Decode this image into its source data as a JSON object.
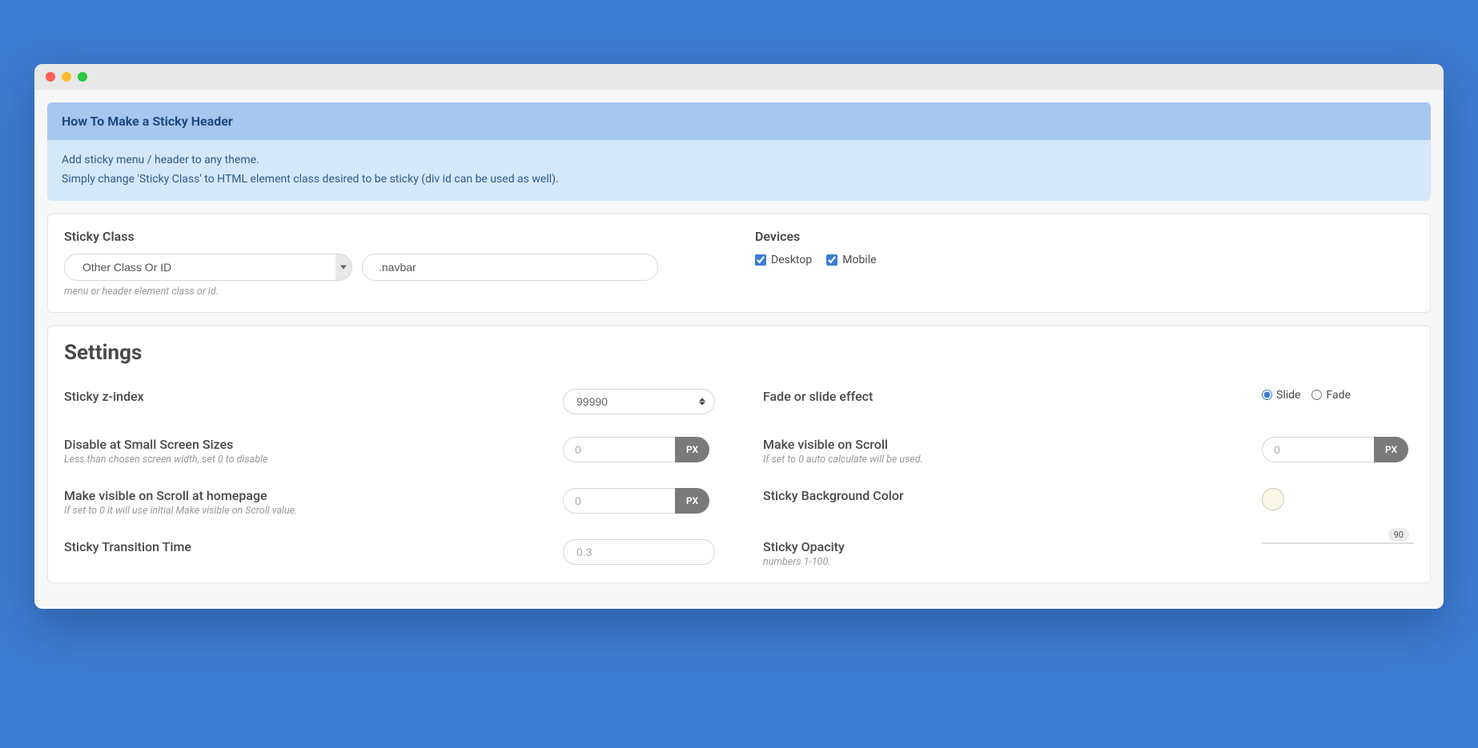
{
  "header": {
    "title": "How To Make a Sticky Header",
    "line1": "Add sticky menu / header to any theme.",
    "line2": "Simply change 'Sticky Class' to HTML element class desired to be sticky (div id can be used as well)."
  },
  "sticky_class": {
    "label": "Sticky Class",
    "select": "Other Class Or ID",
    "value": ".navbar",
    "hint": "menu or header element class or id."
  },
  "devices": {
    "label": "Devices",
    "desktop": "Desktop",
    "mobile": "Mobile"
  },
  "settings": {
    "title": "Settings",
    "z_index": {
      "label": "Sticky z-index",
      "value": "99990"
    },
    "effect": {
      "label": "Fade or slide effect",
      "slide": "Slide",
      "fade": "Fade"
    },
    "disable_small": {
      "label": "Disable at Small Screen Sizes",
      "hint": "Less than chosen screen width, set 0 to disable",
      "placeholder": "0",
      "unit": "PX"
    },
    "visible_scroll": {
      "label": "Make visible on Scroll",
      "hint": "If set to 0 auto calculate will be used.",
      "placeholder": "0",
      "unit": "PX"
    },
    "visible_home": {
      "label": "Make visible on Scroll at homepage",
      "hint": "If set to 0 it will use initial Make visible on Scroll value.",
      "placeholder": "0",
      "unit": "PX"
    },
    "bg_color": {
      "label": "Sticky Background Color",
      "value": "#faf6e8"
    },
    "transition": {
      "label": "Sticky Transition Time",
      "placeholder": "0.3"
    },
    "opacity": {
      "label": "Sticky Opacity",
      "hint": "numbers 1-100.",
      "value": "90"
    }
  }
}
